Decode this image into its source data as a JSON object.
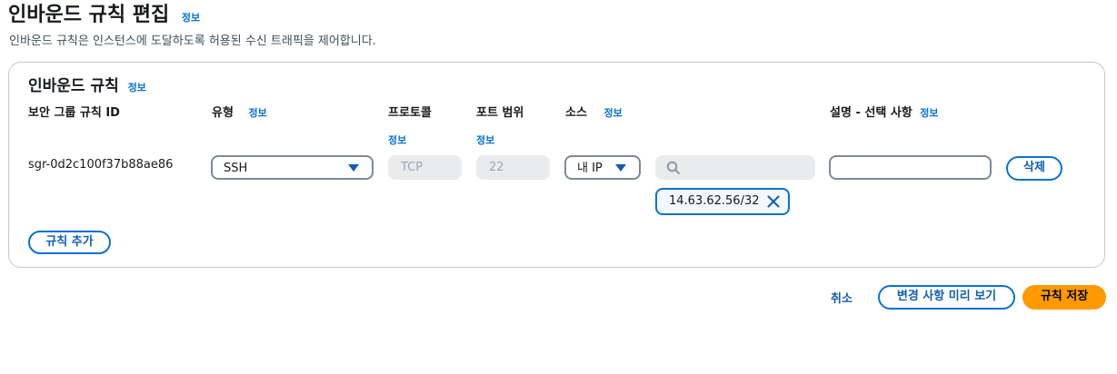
{
  "header": {
    "title": "인바운드 규칙 편집",
    "info": "정보",
    "description": "인바운드 규칙은 인스턴스에 도달하도록 허용된 수신 트래픽을 제어합니다."
  },
  "panel": {
    "title": "인바운드 규칙",
    "info": "정보",
    "columns": {
      "rule_id": "보안 그룹 규칙 ID",
      "type": "유형",
      "type_info": "정보",
      "protocol": "프로토콜",
      "protocol_info": "정보",
      "port_range": "포트 범위",
      "port_range_info": "정보",
      "source": "소스",
      "source_info": "정보",
      "description": "설명 - 선택 사항",
      "description_info": "정보"
    },
    "rules": [
      {
        "rule_id": "sgr-0d2c100f37b88ae86",
        "type": "SSH",
        "protocol": "TCP",
        "port_range": "22",
        "source": "내 IP",
        "search_placeholder": "",
        "cidr": "14.63.62.56/32",
        "description": "",
        "delete_label": "삭제"
      }
    ],
    "add_rule_label": "규칙 추가"
  },
  "footer": {
    "cancel_label": "취소",
    "preview_label": "변경 사항 미리 보기",
    "save_label": "규칙 저장"
  },
  "colors": {
    "accent": "#0972d3",
    "primary_button": "#ff9900",
    "border": "#7d8998"
  },
  "icons": [
    "caret-down-icon",
    "search-icon",
    "close-icon"
  ]
}
